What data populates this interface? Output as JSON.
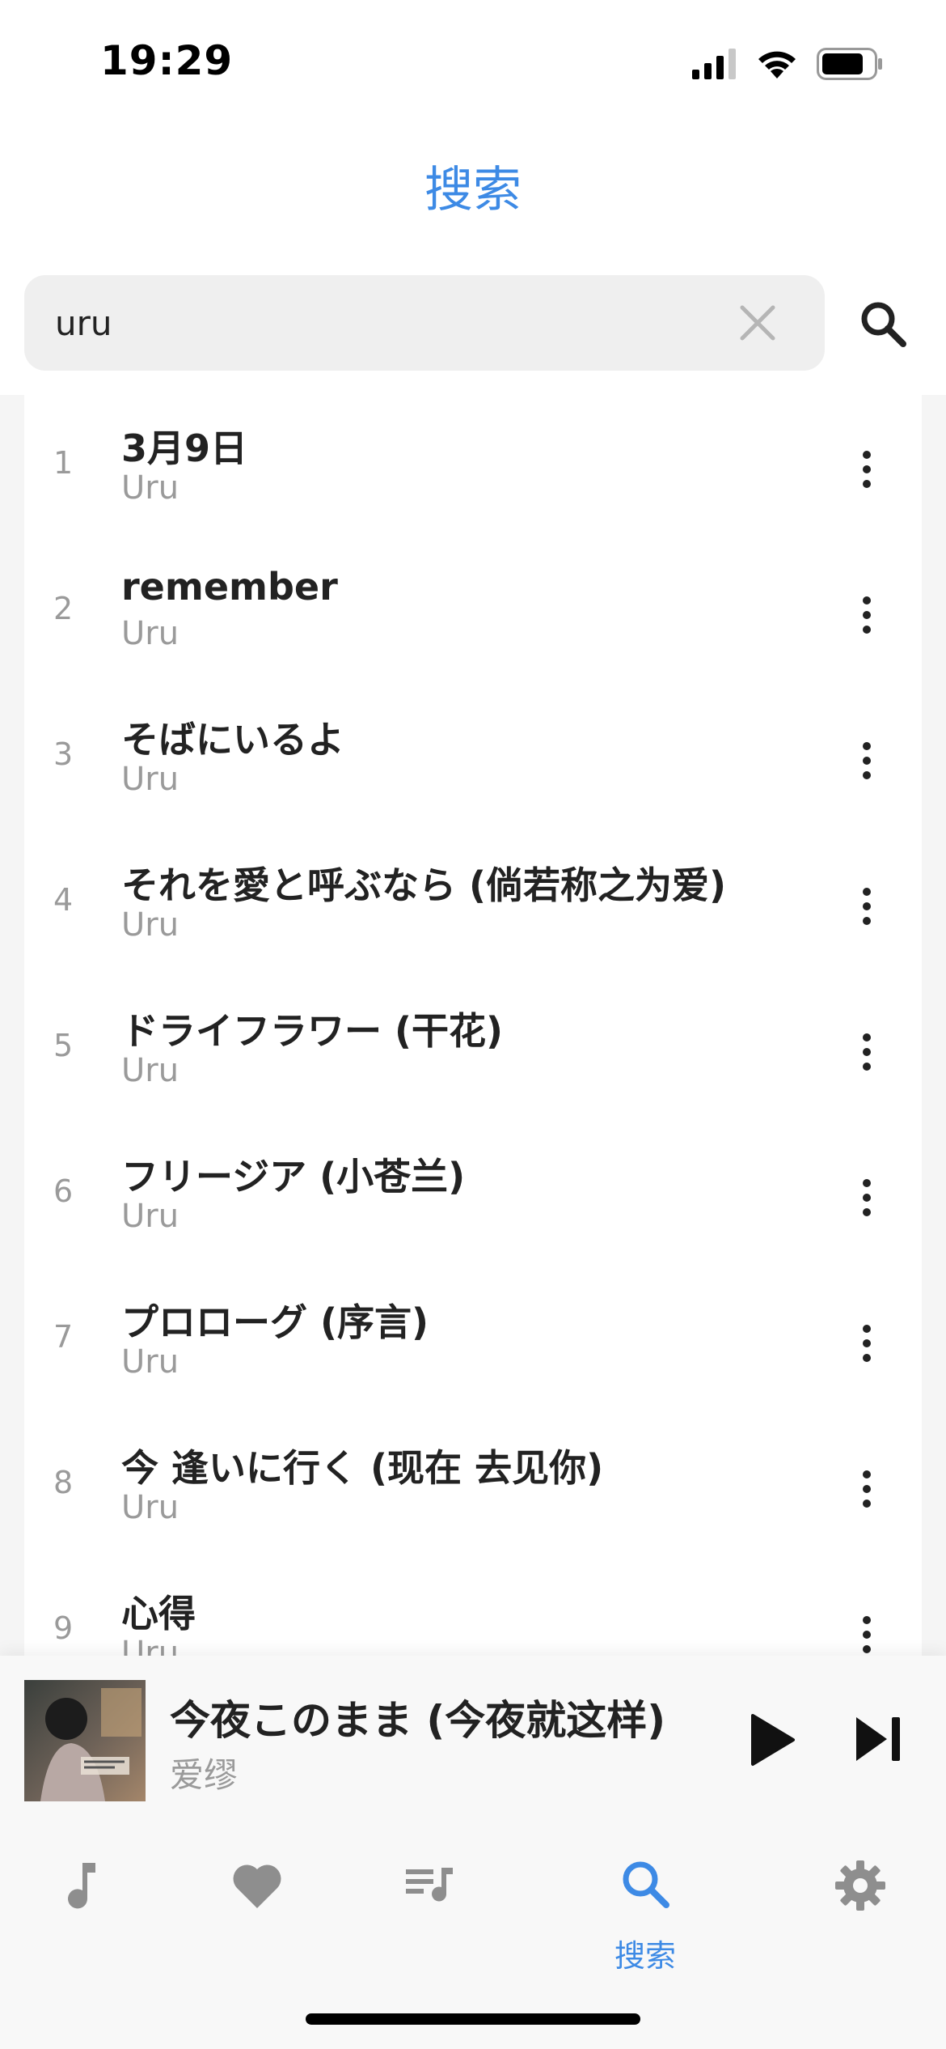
{
  "status_bar": {
    "time": "19:29"
  },
  "header": {
    "title": "搜索"
  },
  "search": {
    "value": "uru",
    "placeholder": ""
  },
  "results": [
    {
      "index": "1",
      "title": "3月9日",
      "artist": "Uru"
    },
    {
      "index": "2",
      "title": "remember",
      "artist": "Uru"
    },
    {
      "index": "3",
      "title": "そばにいるよ",
      "artist": "Uru"
    },
    {
      "index": "4",
      "title": "それを愛と呼ぶなら (倘若称之为爱)",
      "artist": "Uru"
    },
    {
      "index": "5",
      "title": "ドライフラワー (干花)",
      "artist": "Uru"
    },
    {
      "index": "6",
      "title": "フリージア (小苍兰)",
      "artist": "Uru"
    },
    {
      "index": "7",
      "title": "プロローグ (序言)",
      "artist": "Uru"
    },
    {
      "index": "8",
      "title": "今 逢いに行く (现在 去见你)",
      "artist": "Uru"
    },
    {
      "index": "9",
      "title": "心得",
      "artist": "Uru"
    }
  ],
  "now_playing": {
    "title": "今夜このまま (今夜就这样)",
    "artist": "爱缪"
  },
  "tabs": [
    {
      "icon": "music-note-icon",
      "label": ""
    },
    {
      "icon": "heart-icon",
      "label": ""
    },
    {
      "icon": "playlist-icon",
      "label": ""
    },
    {
      "icon": "search-icon",
      "label": "搜索",
      "active": true
    },
    {
      "icon": "gear-icon",
      "label": ""
    }
  ],
  "colors": {
    "accent": "#3d8ae5",
    "secondary_text": "#9a9a9a",
    "primary_text": "#222222",
    "icon_gray": "#8e8e8e"
  }
}
